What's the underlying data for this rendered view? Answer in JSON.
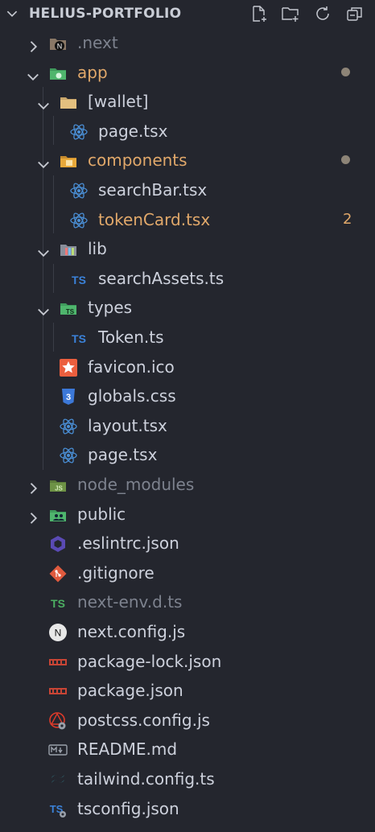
{
  "explorer": {
    "title": "HELIUS-PORTFOLIO",
    "actions": [
      "New File",
      "New Folder",
      "Refresh Explorer",
      "Collapse Folders in Explorer"
    ]
  },
  "tree": [
    {
      "label": ".next",
      "icon": "next-folder-icon",
      "kind": "folder",
      "expanded": false,
      "dim": true
    },
    {
      "label": "app",
      "icon": "app-folder-icon",
      "kind": "folder",
      "expanded": true,
      "status": "modified"
    },
    {
      "label": "[wallet]",
      "icon": "folder-icon",
      "kind": "folder",
      "expanded": true
    },
    {
      "label": "page.tsx",
      "icon": "react-icon",
      "kind": "file"
    },
    {
      "label": "components",
      "icon": "components-folder-icon",
      "kind": "folder",
      "expanded": true,
      "status": "modified"
    },
    {
      "label": "searchBar.tsx",
      "icon": "react-icon",
      "kind": "file"
    },
    {
      "label": "tokenCard.tsx",
      "icon": "react-icon",
      "kind": "file",
      "badge": "2"
    },
    {
      "label": "lib",
      "icon": "lib-folder-icon",
      "kind": "folder",
      "expanded": true
    },
    {
      "label": "searchAssets.ts",
      "icon": "typescript-icon",
      "kind": "file"
    },
    {
      "label": "types",
      "icon": "types-folder-icon",
      "kind": "folder",
      "expanded": true
    },
    {
      "label": "Token.ts",
      "icon": "typescript-icon",
      "kind": "file"
    },
    {
      "label": "favicon.ico",
      "icon": "favicon-icon",
      "kind": "file"
    },
    {
      "label": "globals.css",
      "icon": "css-icon",
      "kind": "file"
    },
    {
      "label": "layout.tsx",
      "icon": "react-icon",
      "kind": "file"
    },
    {
      "label": "page.tsx",
      "icon": "react-icon",
      "kind": "file"
    },
    {
      "label": "node_modules",
      "icon": "node-folder-icon",
      "kind": "folder",
      "expanded": false,
      "dim": true
    },
    {
      "label": "public",
      "icon": "public-folder-icon",
      "kind": "folder",
      "expanded": false
    },
    {
      "label": ".eslintrc.json",
      "icon": "eslint-icon",
      "kind": "file"
    },
    {
      "label": ".gitignore",
      "icon": "git-icon",
      "kind": "file"
    },
    {
      "label": "next-env.d.ts",
      "icon": "ts-def-icon",
      "kind": "file",
      "dim": true
    },
    {
      "label": "next.config.js",
      "icon": "next-icon",
      "kind": "file"
    },
    {
      "label": "package-lock.json",
      "icon": "npm-icon",
      "kind": "file"
    },
    {
      "label": "package.json",
      "icon": "npm-icon",
      "kind": "file"
    },
    {
      "label": "postcss.config.js",
      "icon": "postcss-icon",
      "kind": "file"
    },
    {
      "label": "README.md",
      "icon": "markdown-icon",
      "kind": "file"
    },
    {
      "label": "tailwind.config.ts",
      "icon": "tailwind-icon",
      "kind": "file"
    },
    {
      "label": "tsconfig.json",
      "icon": "tsconfig-icon",
      "kind": "file"
    }
  ],
  "colors": {
    "background": "#24262e",
    "text": "#cdd1dc",
    "dimmed": "#7d828e",
    "modified": "#e1a86a",
    "dot": "#8d8477"
  }
}
